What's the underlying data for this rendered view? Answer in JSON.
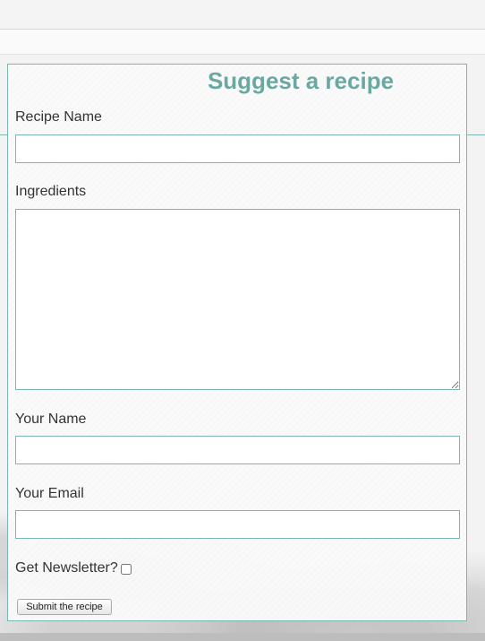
{
  "form": {
    "title": "Suggest a recipe",
    "recipe_name": {
      "label": "Recipe Name",
      "value": "",
      "placeholder": ""
    },
    "ingredients": {
      "label": "Ingredients",
      "value": "",
      "placeholder": ""
    },
    "your_name": {
      "label": "Your Name",
      "value": "",
      "placeholder": ""
    },
    "your_email": {
      "label": "Your Email",
      "value": "",
      "placeholder": ""
    },
    "newsletter": {
      "label": "Get Newsletter?",
      "checked": false
    },
    "submit_label": "Submit the recipe"
  },
  "colors": {
    "accent": "#6aa9a2",
    "border": "#79b8b0"
  }
}
